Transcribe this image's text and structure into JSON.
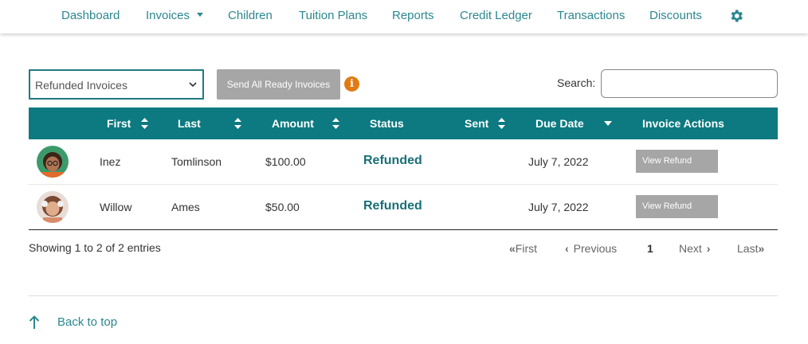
{
  "nav": {
    "items": [
      "Dashboard",
      "Invoices",
      "Children",
      "Tuition Plans",
      "Reports",
      "Credit Ledger",
      "Transactions",
      "Discounts"
    ],
    "settings_icon": "gear-icon",
    "accent_color": "#2b8790"
  },
  "toolbar": {
    "filter_value": "Refunded Invoices",
    "send_button": "Send All Ready Invoices",
    "info_icon": "i",
    "search_label": "Search:",
    "search_value": ""
  },
  "table": {
    "header_color": "#0c7a80",
    "columns": [
      "First",
      "Last",
      "Amount",
      "Status",
      "Sent",
      "Due Date",
      "Invoice Actions"
    ],
    "rows": [
      {
        "first": "Inez",
        "last": "Tomlinson",
        "amount": "$100.00",
        "status": "Refunded",
        "sent": "",
        "due_date": "July 7, 2022",
        "action": "View Refund"
      },
      {
        "first": "Willow",
        "last": "Ames",
        "amount": "$50.00",
        "status": "Refunded",
        "sent": "",
        "due_date": "July 7, 2022",
        "action": "View Refund"
      }
    ]
  },
  "pagination": {
    "info": "Showing 1 to 2 of 2 entries",
    "first": "First",
    "previous": "Previous",
    "current": "1",
    "next": "Next",
    "last": "Last"
  },
  "footer": {
    "back_to_top": "Back to top"
  }
}
